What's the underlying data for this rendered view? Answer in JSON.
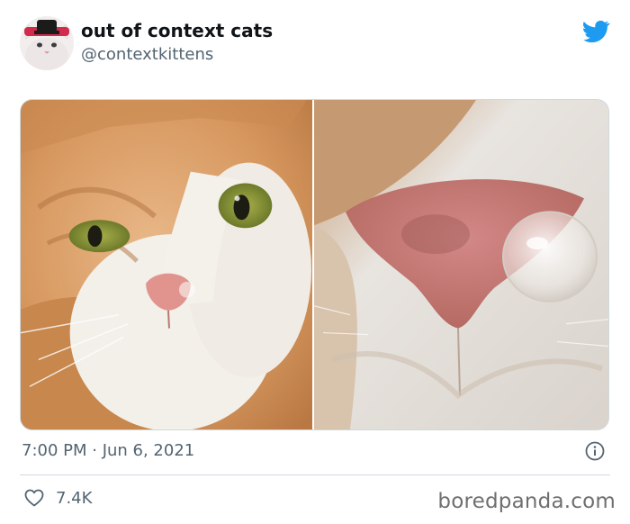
{
  "tweet": {
    "display_name": "out of context cats",
    "handle": "@contextkittens",
    "timestamp": "7:00 PM · Jun 6, 2021",
    "like_count": "7.4K"
  },
  "media": {
    "photos": [
      {
        "icon": "orange-white-cat-face-photo"
      },
      {
        "icon": "cat-nose-with-bubble-closeup-photo"
      }
    ]
  },
  "icons": {
    "brand": "twitter-bird-icon",
    "info": "info-icon",
    "like": "heart-icon"
  },
  "watermark": "boredpanda.com",
  "colors": {
    "twitter_blue": "#1d9bf0",
    "secondary_text": "#536471",
    "divider": "#cfd9de"
  }
}
